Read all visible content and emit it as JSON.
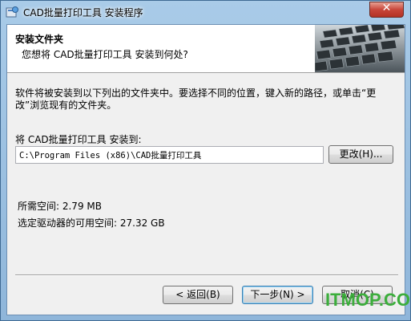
{
  "window": {
    "title": "CAD批量打印工具 安装程序",
    "close_label": "✕"
  },
  "header": {
    "title": "安装文件夹",
    "subtitle": "您想将 CAD批量打印工具 安装到何处?"
  },
  "content": {
    "description": "软件将被安装到以下列出的文件夹中。要选择不同的位置，键入新的路径，或单击“更改”浏览现有的文件夹。",
    "destination_label": "将 CAD批量打印工具 安装到:",
    "install_path": "C:\\Program Files (x86)\\CAD批量打印工具",
    "browse_button": "更改(H)...",
    "space_required": "所需空间: 2.79 MB",
    "space_available": "选定驱动器的可用空间: 27.32 GB"
  },
  "footer": {
    "back_button": "< 返回(B)",
    "next_button": "下一步(N) >",
    "cancel_button": "取消(C)"
  },
  "watermark": "ITMOP.COM",
  "colors": {
    "title_bar": "#a9cbe8",
    "client_bg": "#f0f0f0",
    "close_button": "#c8463a",
    "watermark": "#3cae3c"
  }
}
